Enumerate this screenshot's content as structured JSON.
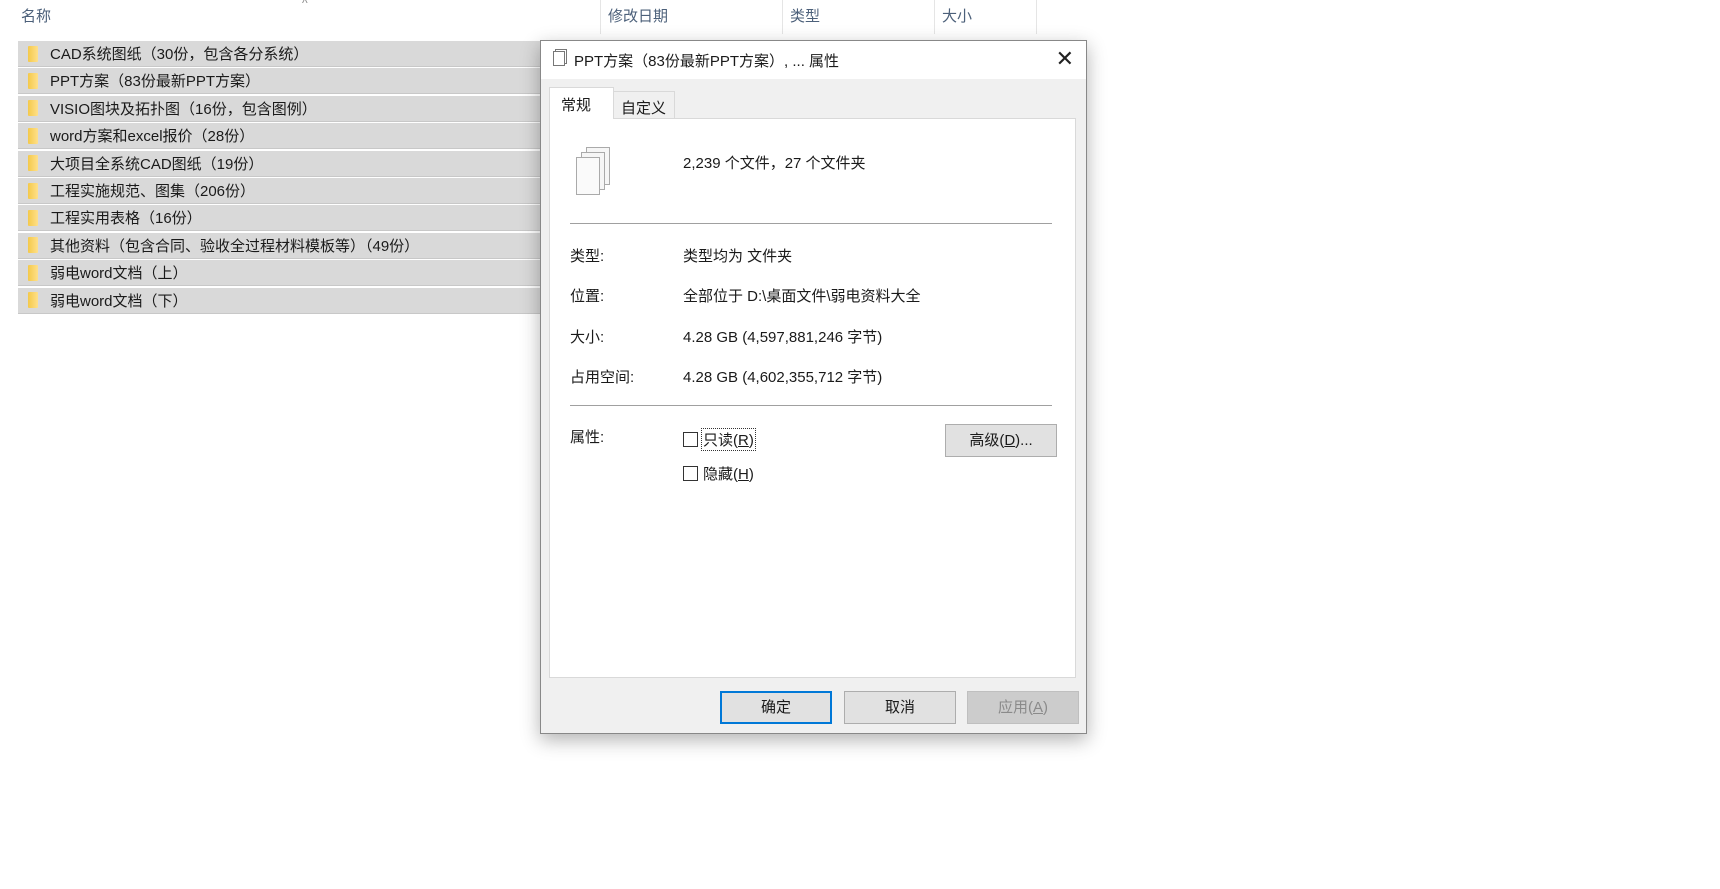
{
  "columns": {
    "name": "名称",
    "modified": "修改日期",
    "type": "类型",
    "size": "大小"
  },
  "folders": [
    "CAD系统图纸（30份，包含各分系统）",
    "PPT方案（83份最新PPT方案）",
    "VISIO图块及拓扑图（16份，包含图例）",
    "word方案和excel报价（28份）",
    "大项目全系统CAD图纸（19份）",
    "工程实施规范、图集（206份）",
    "工程实用表格（16份）",
    "其他资料（包含合同、验收全过程材料模板等）（49份）",
    "弱电word文档（上）",
    "弱电word文档（下）"
  ],
  "dialog": {
    "title": "PPT方案（83份最新PPT方案）, ... 属性",
    "tabs": [
      "常规",
      "自定义"
    ],
    "summary": "2,239 个文件，27 个文件夹",
    "type_label": "类型:",
    "type_value": "类型均为 文件夹",
    "location_label": "位置:",
    "location_value": "全部位于 D:\\桌面文件\\弱电资料大全",
    "size_label": "大小:",
    "size_value": "4.28 GB (4,597,881,246 字节)",
    "disk_label": "占用空间:",
    "disk_value": "4.28 GB (4,602,355,712 字节)",
    "attr_label": "属性:",
    "readonly": {
      "text": "只读(",
      "key": "R",
      "end": ")",
      "checked": false
    },
    "hidden": {
      "text": "隐藏(",
      "key": "H",
      "end": ")",
      "checked": false
    },
    "advanced": {
      "text": "高级(",
      "key": "D",
      "end": ")..."
    },
    "ok": "确定",
    "cancel": "取消",
    "apply": {
      "text": "应用(",
      "key": "A",
      "end": ")"
    }
  }
}
